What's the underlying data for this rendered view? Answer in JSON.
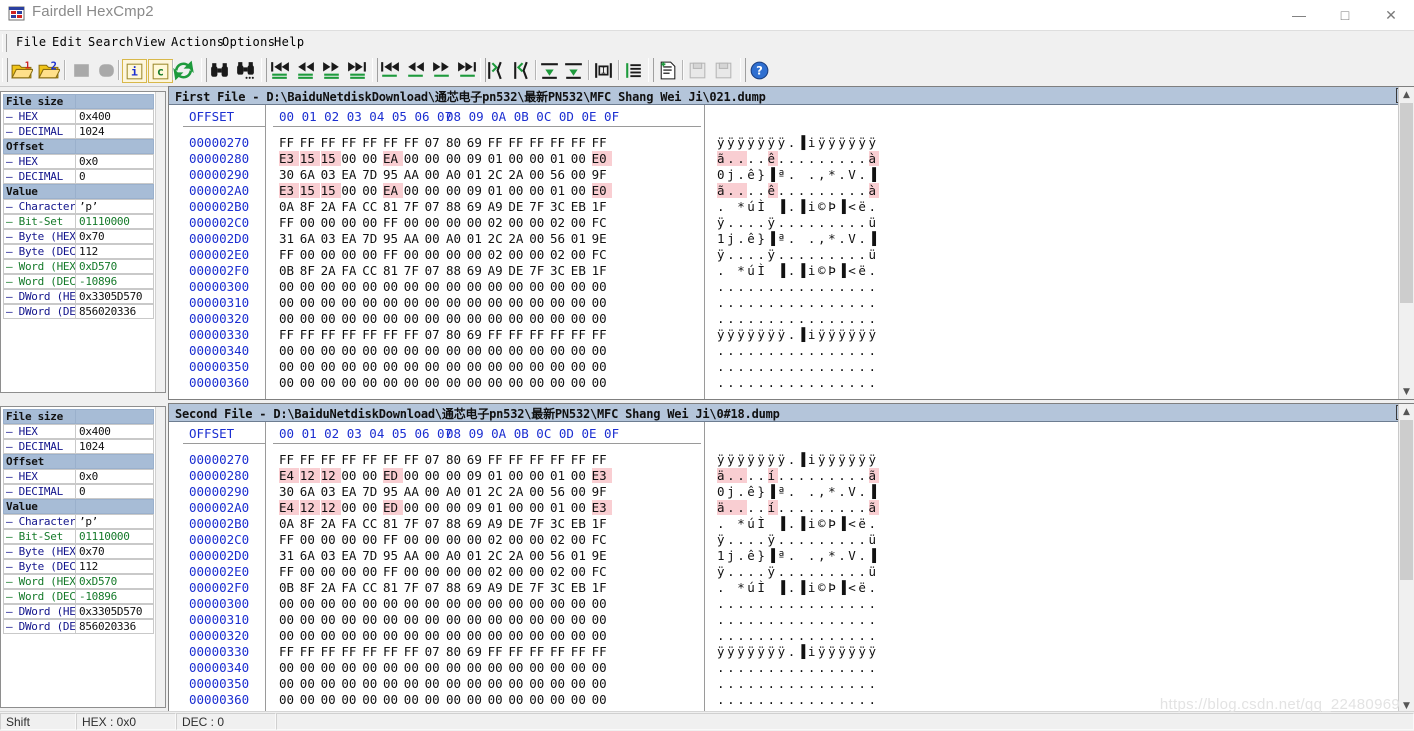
{
  "window": {
    "title": "Fairdell HexCmp2",
    "minimize_label": "—",
    "maximize_label": "□",
    "close_label": "✕",
    "app_icon": "app-window-icon"
  },
  "menu": {
    "items": [
      "File",
      "Edit",
      "Search",
      "View",
      "Actions",
      "Options",
      "Help"
    ]
  },
  "toolbar": {
    "buttons": [
      {
        "name": "open-first-file",
        "icon": "folder-1-icon",
        "enabled": true
      },
      {
        "name": "open-second-file",
        "icon": "folder-2-icon",
        "enabled": true
      },
      {
        "name": "close-first-file",
        "icon": "stop-square-icon",
        "enabled": false
      },
      {
        "name": "close-second-file",
        "icon": "stop-round-icon",
        "enabled": false
      },
      {
        "name": "file-info",
        "icon": "info-i-icon",
        "enabled": true,
        "framed": true
      },
      {
        "name": "compare-c",
        "icon": "compare-c-icon",
        "enabled": true,
        "framed": true
      },
      {
        "name": "refresh-compare",
        "icon": "refresh-arrows-icon",
        "enabled": true
      },
      {
        "name": "find",
        "icon": "binoculars-icon",
        "enabled": true
      },
      {
        "name": "find-next",
        "icon": "binoculars-dots-icon",
        "enabled": true
      },
      {
        "name": "first-difference",
        "icon": "skip-first-diff-icon",
        "enabled": true
      },
      {
        "name": "previous-difference",
        "icon": "prev-diff-icon",
        "enabled": true
      },
      {
        "name": "next-difference",
        "icon": "next-diff-icon",
        "enabled": true
      },
      {
        "name": "last-difference",
        "icon": "skip-last-diff-icon",
        "enabled": true
      },
      {
        "name": "first-equal-block",
        "icon": "skip-first-equal-icon",
        "enabled": true
      },
      {
        "name": "previous-equal-block",
        "icon": "prev-equal-icon",
        "enabled": true
      },
      {
        "name": "next-equal-block",
        "icon": "next-equal-icon",
        "enabled": true
      },
      {
        "name": "last-equal-block",
        "icon": "skip-last-equal-icon",
        "enabled": true
      },
      {
        "name": "synchronize-left",
        "icon": "sync-left-icon",
        "enabled": true
      },
      {
        "name": "synchronize-right",
        "icon": "sync-right-icon",
        "enabled": true
      },
      {
        "name": "align-top",
        "icon": "align-top-icon",
        "enabled": true
      },
      {
        "name": "align-bottom",
        "icon": "align-bottom-icon",
        "enabled": true
      },
      {
        "name": "select-block",
        "icon": "select-block-icon",
        "enabled": true
      },
      {
        "name": "report-lines",
        "icon": "report-lines-icon",
        "enabled": true
      },
      {
        "name": "new-report",
        "icon": "new-report-icon",
        "enabled": true
      },
      {
        "name": "save-report-a",
        "icon": "save-report-icon",
        "enabled": false
      },
      {
        "name": "save-report-b",
        "icon": "save-report-alt-icon",
        "enabled": false
      },
      {
        "name": "help",
        "icon": "help-question-icon",
        "enabled": true
      }
    ]
  },
  "info_panel": {
    "rows": [
      {
        "label": "File size",
        "value": "",
        "header": true,
        "color": "black"
      },
      {
        "label": "– HEX",
        "value": "0x400",
        "header": false,
        "color": "blue"
      },
      {
        "label": "– DECIMAL",
        "value": "1024",
        "header": false,
        "color": "blue"
      },
      {
        "label": "Offset",
        "value": "",
        "header": true,
        "color": "black"
      },
      {
        "label": "– HEX",
        "value": "0x0",
        "header": false,
        "color": "blue"
      },
      {
        "label": "– DECIMAL",
        "value": "0",
        "header": false,
        "color": "blue"
      },
      {
        "label": "Value",
        "value": "",
        "header": true,
        "color": "black"
      },
      {
        "label": "– Character",
        "value": "’p’",
        "header": false,
        "color": "blue"
      },
      {
        "label": "– Bit-Set",
        "value": "01110000",
        "header": false,
        "color": "green"
      },
      {
        "label": "– Byte (HEX)",
        "value": "0x70",
        "header": false,
        "color": "blue"
      },
      {
        "label": "– Byte (DEC)",
        "value": "112",
        "header": false,
        "color": "blue"
      },
      {
        "label": "– Word (HEX)",
        "value": "0xD570",
        "header": false,
        "color": "green"
      },
      {
        "label": "– Word (DEC)",
        "value": "-10896",
        "header": false,
        "color": "green"
      },
      {
        "label": "– DWord (HEX)",
        "value": "0x3305D570",
        "header": false,
        "color": "blue"
      },
      {
        "label": "– DWord (DEC)",
        "value": "856020336",
        "header": false,
        "color": "blue"
      }
    ]
  },
  "hex_columns": {
    "offset_header": "OFFSET",
    "group_a": "00 01 02 03 04 05 06 07",
    "group_b": "08 09 0A 0B 0C 0D 0E 0F"
  },
  "first_pane": {
    "title": "First File - D:\\BaiduNetdiskDownload\\通芯电子pn532\\最新PN532\\MFC Shang Wei Ji\\021.dump",
    "close_label": "✕",
    "rows": [
      {
        "offset": "00000270",
        "a": "FF FF FF FF FF FF FF 07",
        "b": "80 69 FF FF FF FF FF FF",
        "ascii": "ÿÿÿÿÿÿÿ.▐iÿÿÿÿÿÿ",
        "hl": []
      },
      {
        "offset": "00000280",
        "a": "E3 15 15 00 00 EA 00 00",
        "b": "00 09 01 00 00 01 00 E0",
        "ascii": "ã....ê.........à",
        "hl": [
          0,
          1,
          2,
          5,
          15
        ]
      },
      {
        "offset": "00000290",
        "a": "30 6A 03 EA 7D 95 AA 00",
        "b": "A0 01 2C 2A 00 56 00 9F",
        "ascii": "0j.ê}▐ª. .,*.V.▐",
        "hl": []
      },
      {
        "offset": "000002A0",
        "a": "E3 15 15 00 00 EA 00 00",
        "b": "00 09 01 00 00 01 00 E0",
        "ascii": "ã....ê.........à",
        "hl": [
          0,
          1,
          2,
          5,
          15
        ]
      },
      {
        "offset": "000002B0",
        "a": "0A 8F 2A FA CC 81 7F 07",
        "b": "88 69 A9 DE 7F 3C EB 1F",
        "ascii": ". *úÌ ▐.▐i©Þ▐<ë.",
        "hl": []
      },
      {
        "offset": "000002C0",
        "a": "FF 00 00 00 00 FF 00 00",
        "b": "00 00 02 00 00 02 00 FC",
        "ascii": "ÿ....ÿ.........ü",
        "hl": []
      },
      {
        "offset": "000002D0",
        "a": "31 6A 03 EA 7D 95 AA 00",
        "b": "A0 01 2C 2A 00 56 01 9E",
        "ascii": "1j.ê}▐ª. .,*.V.▐",
        "hl": []
      },
      {
        "offset": "000002E0",
        "a": "FF 00 00 00 00 FF 00 00",
        "b": "00 00 02 00 00 02 00 FC",
        "ascii": "ÿ....ÿ.........ü",
        "hl": []
      },
      {
        "offset": "000002F0",
        "a": "0B 8F 2A FA CC 81 7F 07",
        "b": "88 69 A9 DE 7F 3C EB 1F",
        "ascii": ". *úÌ ▐.▐i©Þ▐<ë.",
        "hl": []
      },
      {
        "offset": "00000300",
        "a": "00 00 00 00 00 00 00 00",
        "b": "00 00 00 00 00 00 00 00",
        "ascii": "................",
        "hl": []
      },
      {
        "offset": "00000310",
        "a": "00 00 00 00 00 00 00 00",
        "b": "00 00 00 00 00 00 00 00",
        "ascii": "................",
        "hl": []
      },
      {
        "offset": "00000320",
        "a": "00 00 00 00 00 00 00 00",
        "b": "00 00 00 00 00 00 00 00",
        "ascii": "................",
        "hl": []
      },
      {
        "offset": "00000330",
        "a": "FF FF FF FF FF FF FF 07",
        "b": "80 69 FF FF FF FF FF FF",
        "ascii": "ÿÿÿÿÿÿÿ.▐iÿÿÿÿÿÿ",
        "hl": []
      },
      {
        "offset": "00000340",
        "a": "00 00 00 00 00 00 00 00",
        "b": "00 00 00 00 00 00 00 00",
        "ascii": "................",
        "hl": []
      },
      {
        "offset": "00000350",
        "a": "00 00 00 00 00 00 00 00",
        "b": "00 00 00 00 00 00 00 00",
        "ascii": "................",
        "hl": []
      },
      {
        "offset": "00000360",
        "a": "00 00 00 00 00 00 00 00",
        "b": "00 00 00 00 00 00 00 00",
        "ascii": "................",
        "hl": []
      }
    ]
  },
  "second_pane": {
    "title": "Second File - D:\\BaiduNetdiskDownload\\通芯电子pn532\\最新PN532\\MFC Shang Wei Ji\\0#18.dump",
    "close_label": "✕",
    "rows": [
      {
        "offset": "00000270",
        "a": "FF FF FF FF FF FF FF 07",
        "b": "80 69 FF FF FF FF FF FF",
        "ascii": "ÿÿÿÿÿÿÿ.▐iÿÿÿÿÿÿ",
        "hl": []
      },
      {
        "offset": "00000280",
        "a": "E4 12 12 00 00 ED 00 00",
        "b": "00 09 01 00 00 01 00 E3",
        "ascii": "ä....í.........ã",
        "hl": [
          0,
          1,
          2,
          5,
          15
        ]
      },
      {
        "offset": "00000290",
        "a": "30 6A 03 EA 7D 95 AA 00",
        "b": "A0 01 2C 2A 00 56 00 9F",
        "ascii": "0j.ê}▐ª. .,*.V.▐",
        "hl": []
      },
      {
        "offset": "000002A0",
        "a": "E4 12 12 00 00 ED 00 00",
        "b": "00 09 01 00 00 01 00 E3",
        "ascii": "ä....í.........ã",
        "hl": [
          0,
          1,
          2,
          5,
          15
        ]
      },
      {
        "offset": "000002B0",
        "a": "0A 8F 2A FA CC 81 7F 07",
        "b": "88 69 A9 DE 7F 3C EB 1F",
        "ascii": ". *úÌ ▐.▐i©Þ▐<ë.",
        "hl": []
      },
      {
        "offset": "000002C0",
        "a": "FF 00 00 00 00 FF 00 00",
        "b": "00 00 02 00 00 02 00 FC",
        "ascii": "ÿ....ÿ.........ü",
        "hl": []
      },
      {
        "offset": "000002D0",
        "a": "31 6A 03 EA 7D 95 AA 00",
        "b": "A0 01 2C 2A 00 56 01 9E",
        "ascii": "1j.ê}▐ª. .,*.V.▐",
        "hl": []
      },
      {
        "offset": "000002E0",
        "a": "FF 00 00 00 00 FF 00 00",
        "b": "00 00 02 00 00 02 00 FC",
        "ascii": "ÿ....ÿ.........ü",
        "hl": []
      },
      {
        "offset": "000002F0",
        "a": "0B 8F 2A FA CC 81 7F 07",
        "b": "88 69 A9 DE 7F 3C EB 1F",
        "ascii": ". *úÌ ▐.▐i©Þ▐<ë.",
        "hl": []
      },
      {
        "offset": "00000300",
        "a": "00 00 00 00 00 00 00 00",
        "b": "00 00 00 00 00 00 00 00",
        "ascii": "................",
        "hl": []
      },
      {
        "offset": "00000310",
        "a": "00 00 00 00 00 00 00 00",
        "b": "00 00 00 00 00 00 00 00",
        "ascii": "................",
        "hl": []
      },
      {
        "offset": "00000320",
        "a": "00 00 00 00 00 00 00 00",
        "b": "00 00 00 00 00 00 00 00",
        "ascii": "................",
        "hl": []
      },
      {
        "offset": "00000330",
        "a": "FF FF FF FF FF FF FF 07",
        "b": "80 69 FF FF FF FF FF FF",
        "ascii": "ÿÿÿÿÿÿÿ.▐iÿÿÿÿÿÿ",
        "hl": []
      },
      {
        "offset": "00000340",
        "a": "00 00 00 00 00 00 00 00",
        "b": "00 00 00 00 00 00 00 00",
        "ascii": "................",
        "hl": []
      },
      {
        "offset": "00000350",
        "a": "00 00 00 00 00 00 00 00",
        "b": "00 00 00 00 00 00 00 00",
        "ascii": "................",
        "hl": []
      },
      {
        "offset": "00000360",
        "a": "00 00 00 00 00 00 00 00",
        "b": "00 00 00 00 00 00 00 00",
        "ascii": "................",
        "hl": []
      }
    ]
  },
  "status_bar": {
    "mode": "Shift",
    "hex": "HEX : 0x0",
    "dec": "DEC : 0",
    "extra": ""
  },
  "watermark": "https://blog.csdn.net/qq_22480969",
  "colors": {
    "pane_title_bg": "#b4c5da",
    "diff_highlight": "#f9ced2",
    "offset_text": "#1b2ed1",
    "label_blue": "#13158c",
    "label_green": "#157a2a"
  }
}
